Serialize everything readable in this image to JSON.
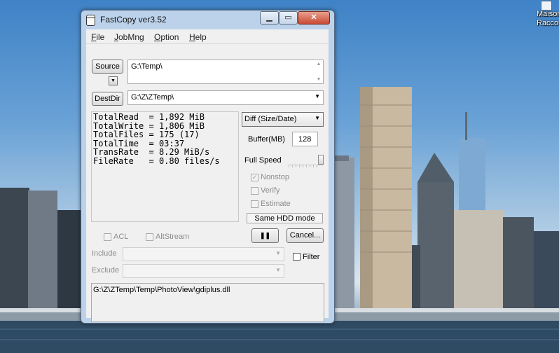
{
  "desktop": {
    "shortcut_label_line1": "Maison",
    "shortcut_label_line2": "Raccou",
    "shortcut_icon": "shortcut-icon"
  },
  "window": {
    "title": "FastCopy ver3.52",
    "minimize_glyph": "▁",
    "maximize_glyph": "▭",
    "close_glyph": "✕"
  },
  "menu": {
    "items": [
      {
        "key": "F",
        "rest": "ile"
      },
      {
        "key": "J",
        "rest": "obMng"
      },
      {
        "key": "O",
        "rest": "ption"
      },
      {
        "key": "H",
        "rest": "elp"
      }
    ]
  },
  "source": {
    "button_label": "Source",
    "value": "G:\\Temp\\"
  },
  "dest": {
    "button_label": "DestDir",
    "value": "G:\\Z\\ZTemp\\"
  },
  "stats": [
    {
      "key": "TotalRead ",
      "value": "1,892 MiB"
    },
    {
      "key": "TotalWrite",
      "value": "1,806 MiB"
    },
    {
      "key": "TotalFiles",
      "value": "175 (17)"
    },
    {
      "key": "TotalTime ",
      "value": "03:37"
    },
    {
      "key": "TransRate ",
      "value": "8.29 MiB/s"
    },
    {
      "key": "FileRate  ",
      "value": "0.80 files/s"
    }
  ],
  "mode": {
    "selected": "Diff (Size/Date)"
  },
  "buffer": {
    "label": "Buffer(MB)",
    "value": "128"
  },
  "speed": {
    "label": "Full Speed",
    "level_fraction": 1.0
  },
  "options": {
    "nonstop": {
      "label": "Nonstop",
      "checked": true
    },
    "verify": {
      "label": "Verify",
      "checked": false
    },
    "estimate": {
      "label": "Estimate",
      "checked": false
    }
  },
  "hdd_mode": "Same HDD mode",
  "actions": {
    "pause_glyph": "❚❚",
    "cancel_label": "Cancel..."
  },
  "acl": {
    "label": "ACL",
    "checked": false
  },
  "altstream": {
    "label": "AltStream",
    "checked": false
  },
  "filters": {
    "include_label": "Include",
    "exclude_label": "Exclude",
    "filter_label": "Filter",
    "filter_checked": false
  },
  "current_file": "G:\\Z\\ZTemp\\Temp\\PhotoView\\gdiplus.dll"
}
